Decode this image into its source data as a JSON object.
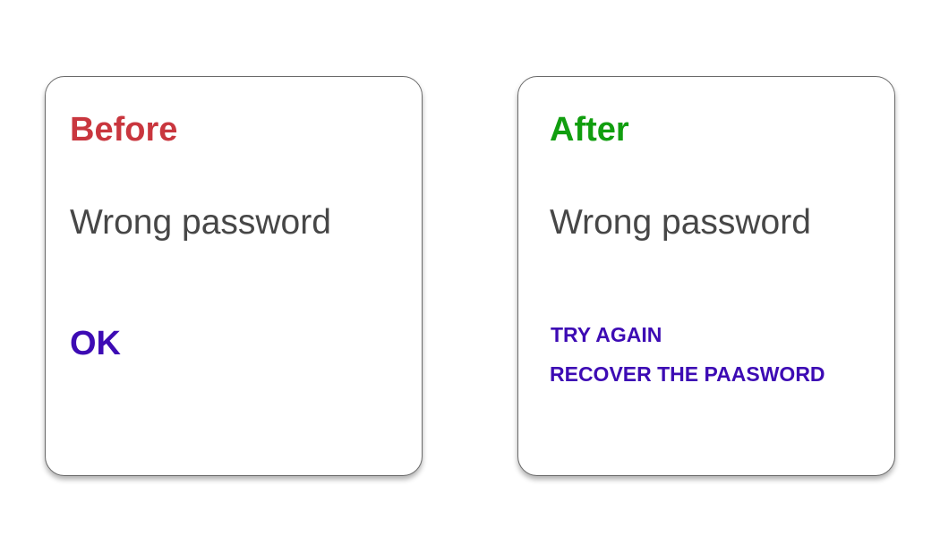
{
  "before": {
    "title": "Before",
    "title_color": "#c9363e",
    "message": "Wrong password",
    "ok_label": "OK"
  },
  "after": {
    "title": "After",
    "title_color": "#119e0f",
    "message": "Wrong password",
    "try_again_label": "TRY AGAIN",
    "recover_label": "RECOVER THE PAASWORD"
  },
  "colors": {
    "action": "#3d0bb4",
    "message": "#474747",
    "card_border": "#6a6a6a"
  }
}
